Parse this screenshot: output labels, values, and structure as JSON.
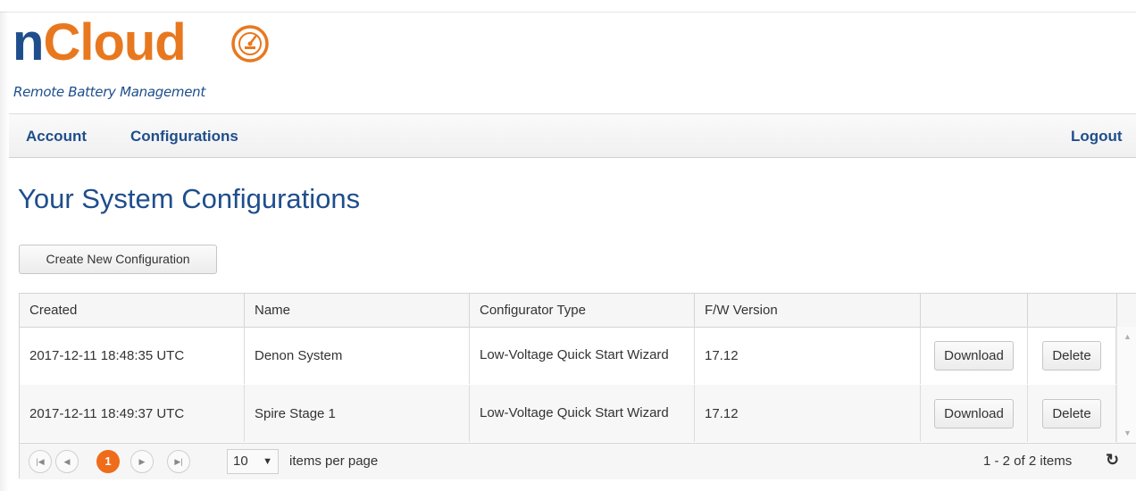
{
  "brand": {
    "logo_n": "n",
    "logo_cloud": "Cloud",
    "tagline": "Remote Battery Management",
    "icon": "gauge-icon",
    "colors": {
      "blue": "#1f4e8c",
      "orange": "#e8781f"
    }
  },
  "nav": {
    "items": [
      {
        "label": "Account"
      },
      {
        "label": "Configurations"
      }
    ],
    "logout": "Logout"
  },
  "page": {
    "title": "Your System Configurations",
    "create_button": "Create New Configuration"
  },
  "grid": {
    "columns": [
      "Created",
      "Name",
      "Configurator Type",
      "F/W Version",
      "",
      ""
    ],
    "rows": [
      {
        "created": "2017-12-11 18:48:35 UTC",
        "name": "Denon System",
        "type": "Low-Voltage Quick Start Wizard",
        "fw": "17.12",
        "download": "Download",
        "delete": "Delete"
      },
      {
        "created": "2017-12-11 18:49:37 UTC",
        "name": "Spire Stage 1",
        "type": "Low-Voltage Quick Start Wizard",
        "fw": "17.12",
        "download": "Download",
        "delete": "Delete"
      }
    ]
  },
  "pager": {
    "current_page": "1",
    "page_size": "10",
    "items_per_page_label": "items per page",
    "info": "1 - 2 of 2 items",
    "icons": [
      "first-page-icon",
      "prev-page-icon",
      "next-page-icon",
      "last-page-icon",
      "dropdown-caret-icon",
      "refresh-icon"
    ],
    "accent": "#ef6c1b"
  }
}
